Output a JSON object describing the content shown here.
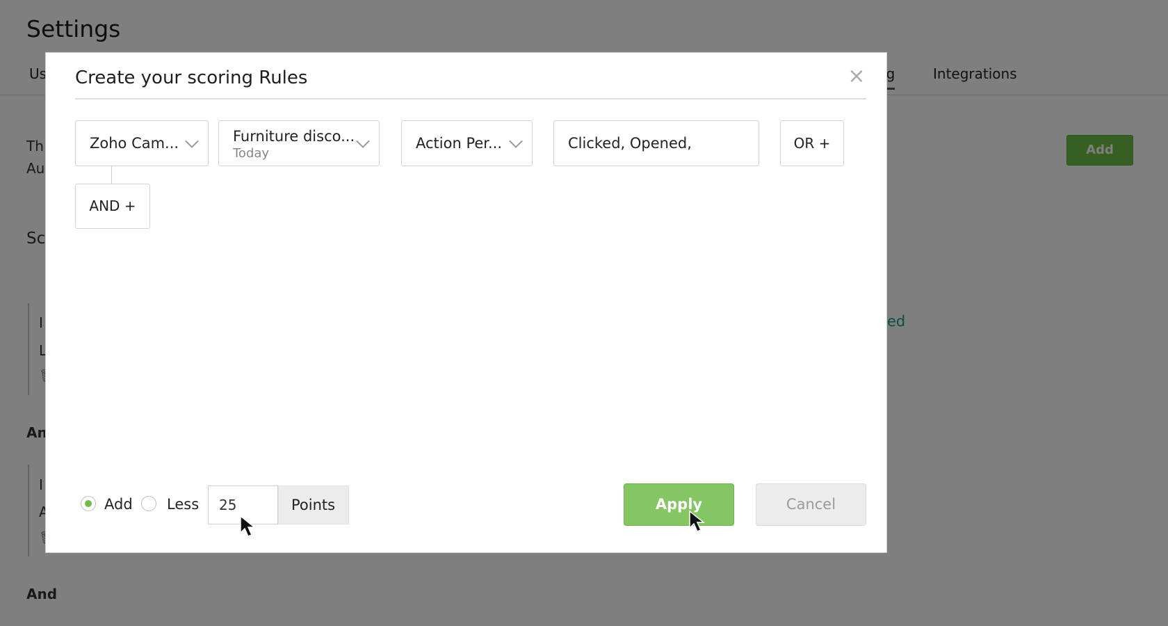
{
  "background": {
    "title": "Settings",
    "tabs": [
      {
        "label": "Us"
      },
      {
        "label": "ng"
      },
      {
        "label": "Integrations"
      }
    ],
    "lines": {
      "p1_a": "Th",
      "p1_b": "Au",
      "section": "Sc",
      "rule1_a": "I",
      "rule1_b": "L",
      "link": "ed",
      "and1": "An",
      "rule2_a": "I",
      "rule2_b": "A",
      "and2": "And"
    },
    "add_button": "Add"
  },
  "modal": {
    "title": "Create your scoring Rules",
    "close_glyph": "×",
    "conditions": {
      "source": "Zoho Cam...",
      "campaign": "Furniture disco...",
      "campaign_sub": "Today",
      "action": "Action Per...",
      "values": "Clicked, Opened,",
      "or_label": "OR +",
      "and_label": "AND +"
    },
    "points": {
      "add_label": "Add",
      "less_label": "Less",
      "selected": "add",
      "value": "25",
      "suffix": "Points"
    },
    "apply_label": "Apply",
    "cancel_label": "Cancel"
  },
  "colors": {
    "accent_green": "#83c662",
    "radio_green": "#6cbf45",
    "link_teal": "#1a9b8d"
  }
}
